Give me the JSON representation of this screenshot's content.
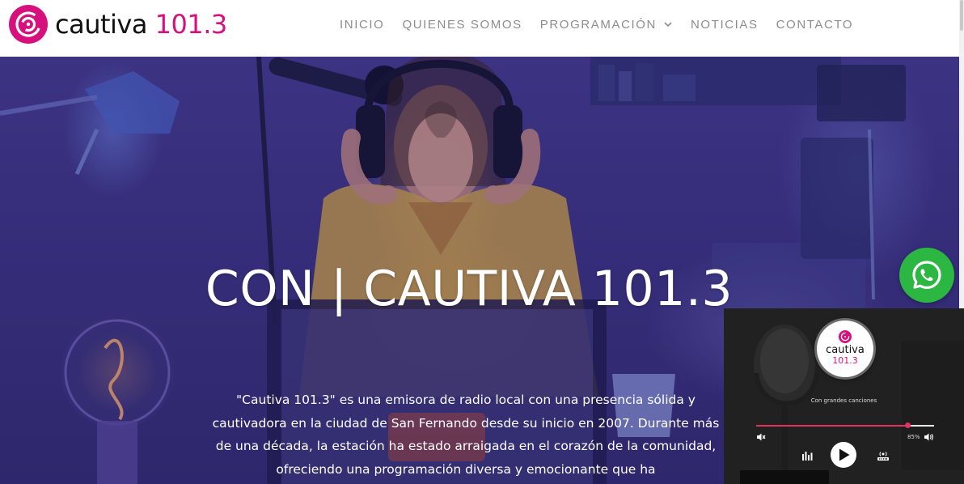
{
  "brand": {
    "name": "cautiva",
    "frequency": "101.3",
    "colors": {
      "magenta": "#d6117d",
      "nav_text": "#8d8d8d",
      "whatsapp": "#2bb741",
      "player_accent": "#e2335f"
    }
  },
  "nav": {
    "items": [
      {
        "label": "INICIO"
      },
      {
        "label": "QUIENES SOMOS"
      },
      {
        "label": "PROGRAMACIÓN",
        "has_dropdown": true
      },
      {
        "label": "NOTICIAS"
      },
      {
        "label": "CONTACTO"
      }
    ]
  },
  "hero": {
    "title": "CON | CAUTIVA 101.3",
    "description": "\"Cautiva 101.3\" es una emisora de radio local con una presencia sólida y cautivadora en la ciudad de San Fernando desde su inicio en 2007. Durante más de una década, la estación ha estado arraigada en el corazón de la comunidad, ofreciendo una programación diversa y emocionante que ha"
  },
  "whatsapp": {
    "icon": "whatsapp-icon"
  },
  "player": {
    "logo_name": "cautiva",
    "logo_freq": "101.3",
    "song": "Con grandes canciones",
    "progress": 0.85,
    "volume_label": "85%",
    "icons": [
      "mute-icon",
      "volume-icon",
      "equalizer-icon",
      "play-icon",
      "live-radio-icon"
    ]
  }
}
